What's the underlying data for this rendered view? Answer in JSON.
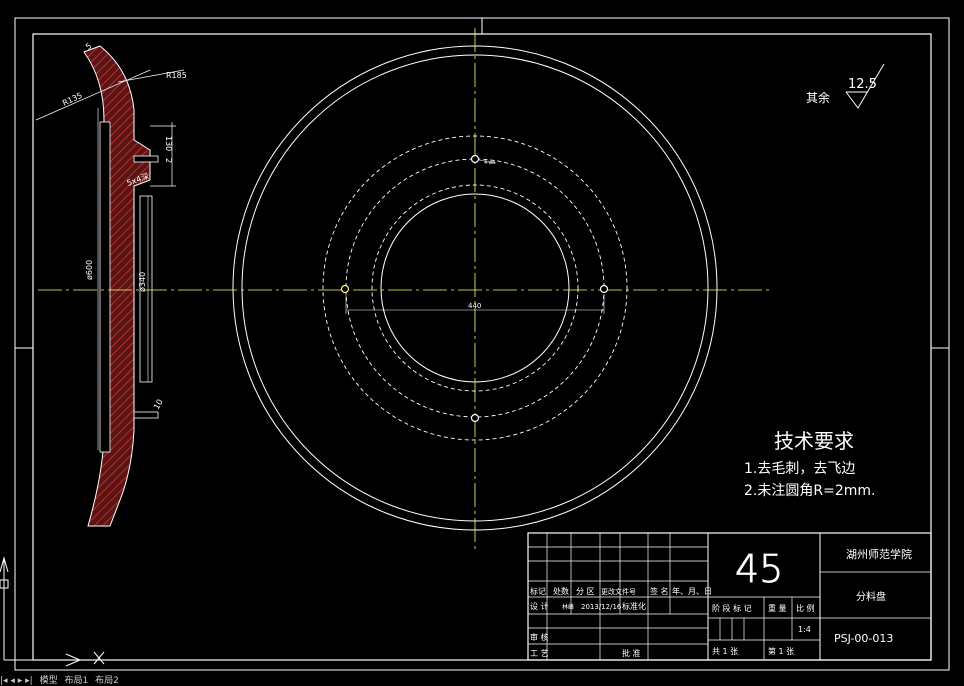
{
  "notes": {
    "heading": "技术要求",
    "line1": "1.去毛刺，去飞边",
    "line2": "2.未注圆角R=2mm."
  },
  "surface": {
    "prefix": "其余",
    "roughness": "12.5"
  },
  "section_dims": {
    "r135": "R135",
    "r185": "R185",
    "d5": "5",
    "d130": "130",
    "d2": "2",
    "angle": "5x4深",
    "dia600": "ø600",
    "dia340": "ø340",
    "d10": "10"
  },
  "plan_dims": {
    "hole_span": "440",
    "hole_tag": "4-ø8"
  },
  "title_block": {
    "school": "湖州师范学院",
    "part_name": "分料盘",
    "quantity": "45",
    "drawing_no": "PSJ-00-013",
    "scale": "1:4",
    "sheets": "共 1 张",
    "sheet_no": "第 1 张",
    "h_mark": "标记",
    "h_count": "处数",
    "h_zone": "分 区",
    "h_docno": "更改文件号",
    "h_sign": "签 名",
    "h_date": "年、月、日",
    "design_label": "设 计",
    "designer": "林峰",
    "design_date": "2013/12/16",
    "std_label": "标准化",
    "review_label": "审 核",
    "process_label": "工 艺",
    "approve_label": "批 准",
    "stage_label": "阶 段 标 记",
    "weight_label": "重 量",
    "scale_label": "比 例"
  },
  "tabs": {
    "model": "模型",
    "layout1": "布局1",
    "layout2": "布局2"
  },
  "colors": {
    "background": "#000000",
    "line": "#ffffff",
    "center": "#ffff66",
    "hatch": "#cc3333",
    "section_fill": "#5a1414"
  }
}
